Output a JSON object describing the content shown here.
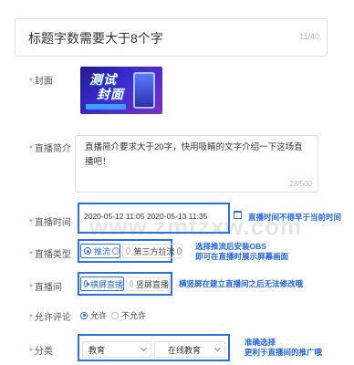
{
  "title": {
    "text": "标题字数需要大于8个字",
    "count": "11/40"
  },
  "labels": {
    "cover": "封面",
    "intro": "直播简介",
    "time": "直播时间",
    "type": "直播类型",
    "screen": "直播间",
    "comment": "允许评论",
    "category": "分类"
  },
  "required_mark": "*",
  "cover_image": {
    "line1": "测试",
    "line2": "封面"
  },
  "intro": {
    "value": "直播简介要求大于20字，快用吸睛的文字介绍一下这场直播吧！",
    "count": "28/500"
  },
  "time": {
    "value": "2020-05-12 11:05  2020-05-13 11:35",
    "icon": "calendar-icon"
  },
  "type_options": [
    {
      "label": "推流",
      "selected": true
    },
    {
      "label": "第三方拉流",
      "selected": false
    }
  ],
  "screen_options": [
    {
      "label": "横屏直播",
      "selected": true
    },
    {
      "label": "竖屏直播",
      "selected": false
    }
  ],
  "comment_options": [
    {
      "label": "允许",
      "selected": true
    },
    {
      "label": "不允许",
      "selected": false
    }
  ],
  "category": {
    "primary": "教育",
    "secondary": "在线教育"
  },
  "notes": {
    "time": "直播时间不得早于当前时间",
    "type_line1": "选择推流后安装OBS",
    "type_line2": "即可在直播时展示屏幕画面",
    "screen": "横竖屏在建立直播间之后无法修改哦",
    "category_line1": "准确选择",
    "category_line2": "更利于直播间的推广哦"
  },
  "watermark": "www.zmtzxw.com",
  "colors": {
    "accent": "#2f6fe0",
    "required": "#f56c6c",
    "border": "#dcdfe6"
  }
}
